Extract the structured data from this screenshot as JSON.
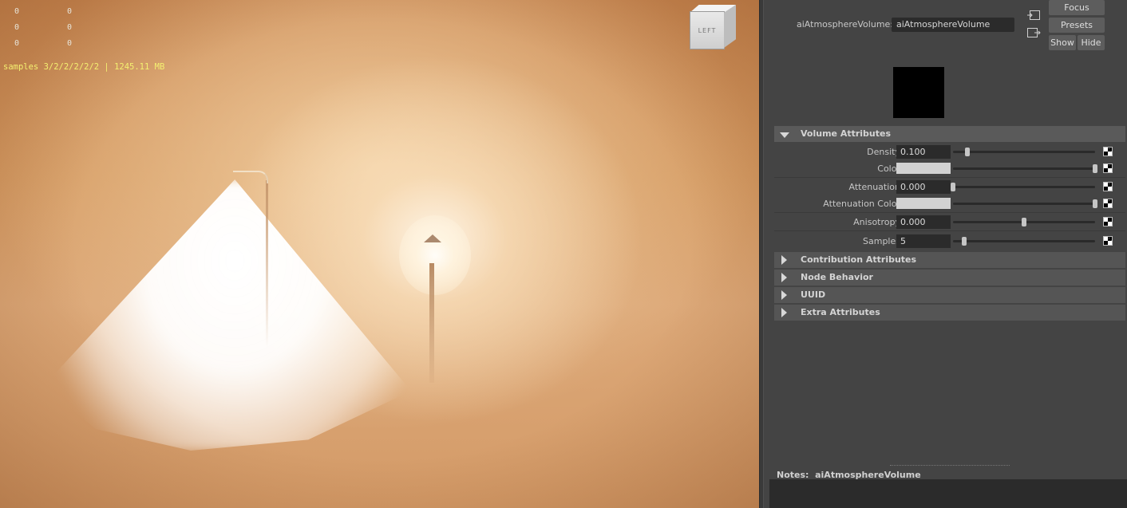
{
  "viewport": {
    "stats": [
      [
        "0",
        "0"
      ],
      [
        "0",
        "0"
      ],
      [
        "0",
        "0"
      ]
    ],
    "samples_text": "samples 3/2/2/2/2/2 | 1245.11 MB",
    "view_cube_label": "LEFT"
  },
  "attribute_editor": {
    "node_label": "aiAtmosphereVolume:",
    "node_name": "aiAtmosphereVolume",
    "buttons": {
      "focus": "Focus",
      "presets": "Presets",
      "show": "Show",
      "hide": "Hide"
    },
    "volume_section": "Volume Attributes",
    "attributes": [
      {
        "label": "Density",
        "value": "0.100",
        "type": "number",
        "slider": 0.1
      },
      {
        "label": "Color",
        "value": "",
        "type": "color",
        "color": "#d2d2d2",
        "slider": 1.0
      },
      {
        "label": "Attenuation",
        "value": "0.000",
        "type": "number",
        "slider": 0.0
      },
      {
        "label": "Attenuation Color",
        "value": "",
        "type": "color",
        "color": "#d2d2d2",
        "slider": 1.0
      },
      {
        "label": "Anisotropy",
        "value": "0.000",
        "type": "number",
        "slider": 0.5
      },
      {
        "label": "Samples",
        "value": "5",
        "type": "number",
        "slider": 0.08
      }
    ],
    "collapsed_sections": [
      "Contribution Attributes",
      "Node Behavior",
      "UUID",
      "Extra Attributes"
    ],
    "notes_label": "Notes:",
    "notes_node": "aiAtmosphereVolume"
  },
  "colors": {
    "panel_bg": "#444444",
    "field_bg": "#2b2b2b",
    "samples_text": "#f4f070"
  },
  "icons": [
    "input-connection-icon",
    "output-connection-icon",
    "expand-arrow-icon",
    "collapse-arrow-icon",
    "map-checker-icon"
  ]
}
